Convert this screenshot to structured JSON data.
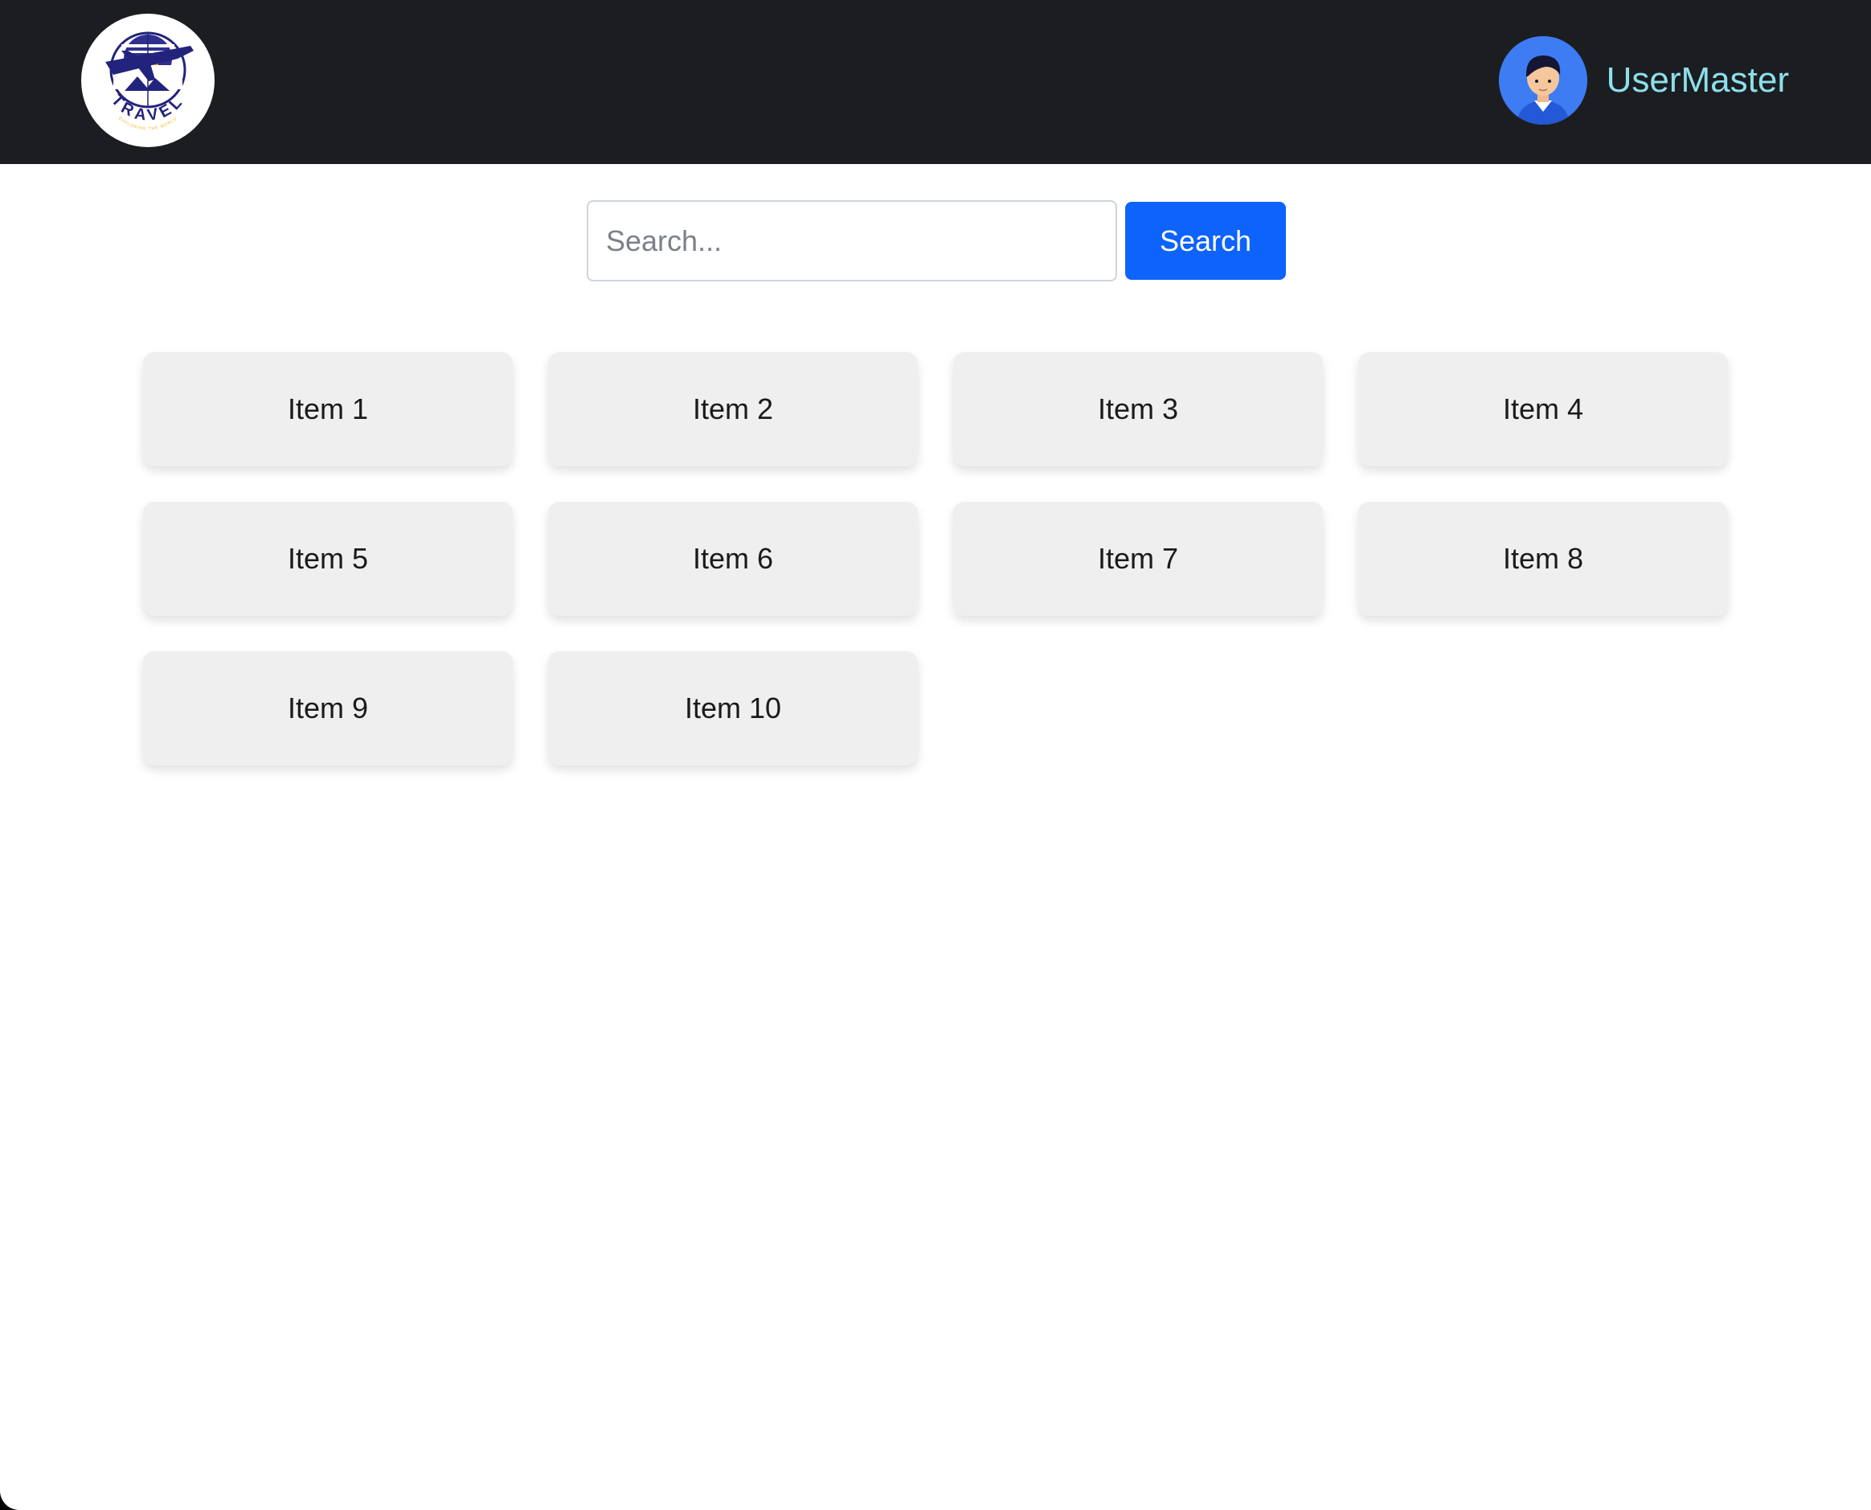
{
  "header": {
    "logo": {
      "text": "TRAVEL",
      "tagline": "EXPLORING THE WORLD",
      "colors": {
        "navy": "#22237c",
        "orange": "#f7941d",
        "gold": "#f5b21b"
      }
    },
    "user": {
      "name": "UserMaster",
      "avatar_bg": "#3d7cf2"
    },
    "background": "#1b1d21"
  },
  "search": {
    "placeholder": "Search...",
    "value": "",
    "button_label": "Search",
    "button_color": "#0d63fb"
  },
  "items": [
    {
      "label": "Item 1"
    },
    {
      "label": "Item 2"
    },
    {
      "label": "Item 3"
    },
    {
      "label": "Item 4"
    },
    {
      "label": "Item 5"
    },
    {
      "label": "Item 6"
    },
    {
      "label": "Item 7"
    },
    {
      "label": "Item 8"
    },
    {
      "label": "Item 9"
    },
    {
      "label": "Item 10"
    }
  ]
}
